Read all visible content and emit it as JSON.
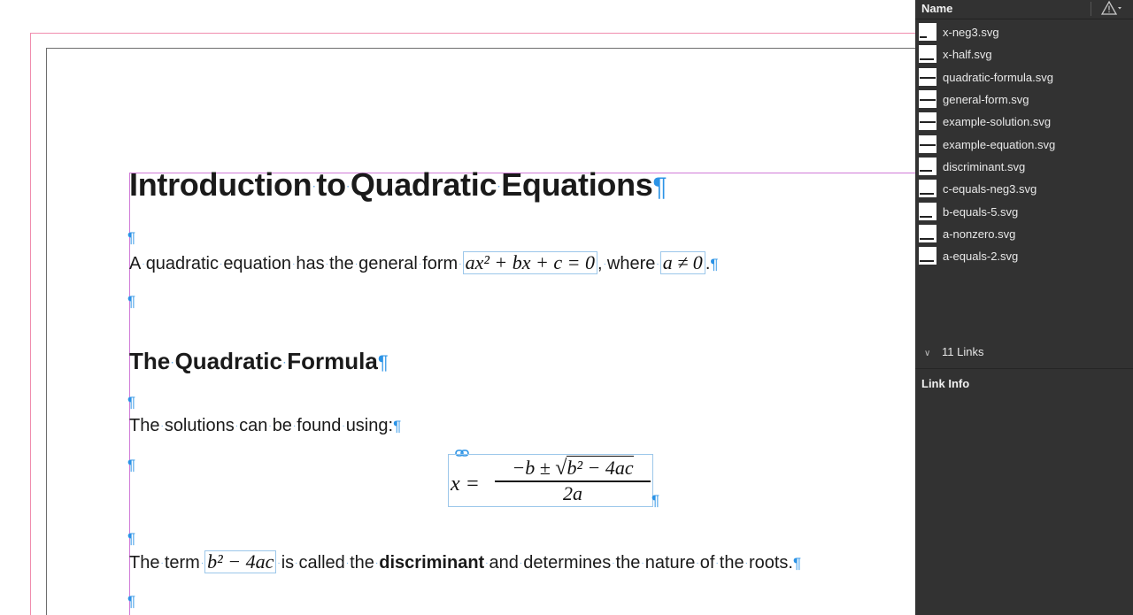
{
  "document": {
    "heading1": {
      "words": [
        "Introduction",
        "to",
        "Quadratic",
        "Equations"
      ]
    },
    "para1": {
      "words": [
        "A",
        "quadratic",
        "equation",
        "has",
        "the",
        "general",
        "form"
      ],
      "eq_general": "ax² + bx + c = 0",
      "after_eq": ",",
      "where": "where",
      "eq_nonzero": "a ≠ 0",
      "end": "."
    },
    "heading2": {
      "words": [
        "The",
        "Quadratic",
        "Formula"
      ]
    },
    "para2": {
      "words": [
        "The",
        "solutions",
        "can",
        "be",
        "found",
        "using:"
      ]
    },
    "formula": {
      "lhs": "x =",
      "numerator_pre": "−b ± ",
      "radical": "√",
      "radicand": "b² − 4ac",
      "denominator": "2a"
    },
    "para3": {
      "pre": [
        "The",
        "term"
      ],
      "eq_term": "b² − 4ac",
      "mid": [
        "is",
        "called",
        "the"
      ],
      "bold": "discriminant",
      "post": [
        "and",
        "determines",
        "the",
        "nature",
        "of",
        "the",
        "roots."
      ]
    },
    "pilcrow": "¶"
  },
  "links_panel": {
    "column_name": "Name",
    "warning_icon": "warning-triangle-icon",
    "items": [
      {
        "name": "x-neg3.svg"
      },
      {
        "name": "x-half.svg"
      },
      {
        "name": "quadratic-formula.svg"
      },
      {
        "name": "general-form.svg"
      },
      {
        "name": "example-solution.svg"
      },
      {
        "name": "example-equation.svg"
      },
      {
        "name": "discriminant.svg"
      },
      {
        "name": "c-equals-neg3.svg"
      },
      {
        "name": "b-equals-5.svg"
      },
      {
        "name": "a-nonzero.svg"
      },
      {
        "name": "a-equals-2.svg"
      }
    ],
    "links_count": "11 Links",
    "link_info": "Link Info"
  },
  "colors": {
    "pilcrow": "#2b93e6",
    "frame_border": "#9cc7ea",
    "panel_bg": "#323232",
    "bleed": "#f08cae",
    "text_frame": "#d07ad8"
  }
}
